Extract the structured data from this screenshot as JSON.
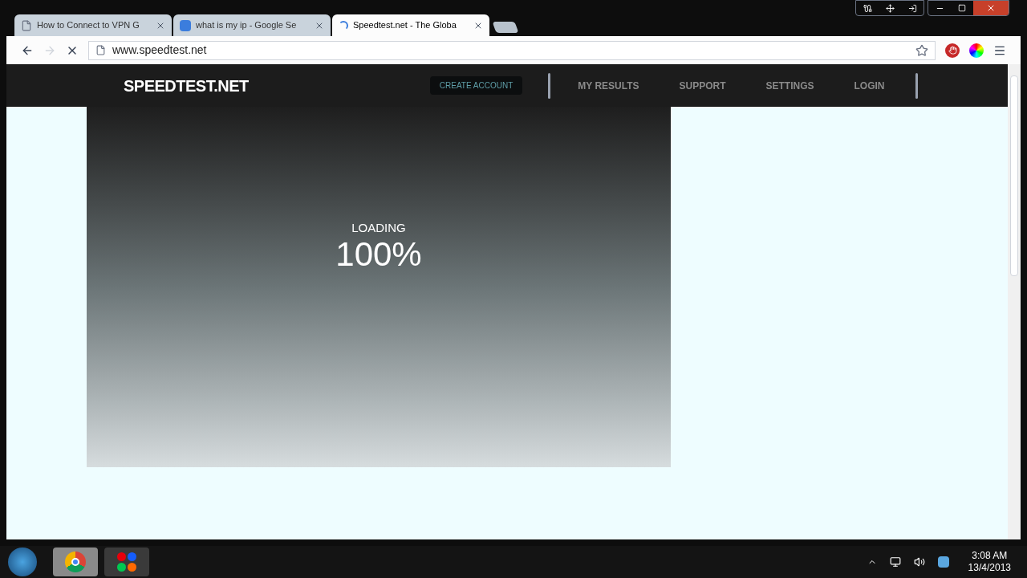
{
  "tabs": [
    {
      "title": "How to Connect to VPN G",
      "kind": "page",
      "selected": false
    },
    {
      "title": "what is my ip - Google Se",
      "kind": "google",
      "selected": false
    },
    {
      "title": "Speedtest.net - The Globa",
      "kind": "loading",
      "selected": true
    }
  ],
  "address_bar": {
    "url": "www.speedtest.net"
  },
  "site": {
    "logo": "SPEEDTEST.NET",
    "create_account": "CREATE ACCOUNT",
    "nav": [
      "MY RESULTS",
      "SUPPORT",
      "SETTINGS",
      "LOGIN"
    ]
  },
  "loader": {
    "label": "LOADING",
    "percent": "100%"
  },
  "taskbar": {
    "time": "3:08 AM",
    "date": "13/4/2013"
  }
}
